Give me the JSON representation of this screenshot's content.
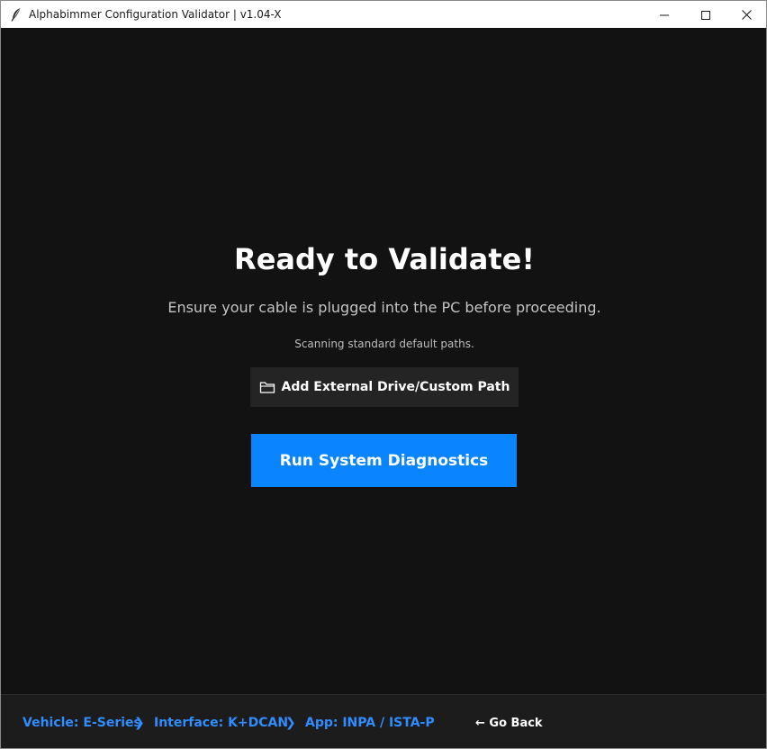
{
  "window": {
    "title": "Alphabimmer Configuration Validator | v1.04-X"
  },
  "main": {
    "heading": "Ready to Validate!",
    "subtext": "Ensure your cable is plugged into the PC before proceeding.",
    "scan_note": "Scanning standard default paths.",
    "add_path_label": "Add External Drive/Custom Path",
    "run_label": "Run System Diagnostics"
  },
  "footer": {
    "breadcrumbs": [
      {
        "label": "Vehicle: E-Series"
      },
      {
        "label": "Interface: K+DCAN"
      },
      {
        "label": "App: INPA / ISTA-P"
      }
    ],
    "separator": "❯",
    "go_back": "← Go Back"
  },
  "colors": {
    "background": "#121212",
    "accent": "#0a84ff",
    "breadcrumb": "#2f8dff",
    "secondary_button": "#242424",
    "footer": "#1c1c1c"
  },
  "icons": {
    "app": "feather-icon",
    "add_path": "folder-icon",
    "minimize": "minimize-icon",
    "maximize": "maximize-icon",
    "close": "close-icon"
  }
}
